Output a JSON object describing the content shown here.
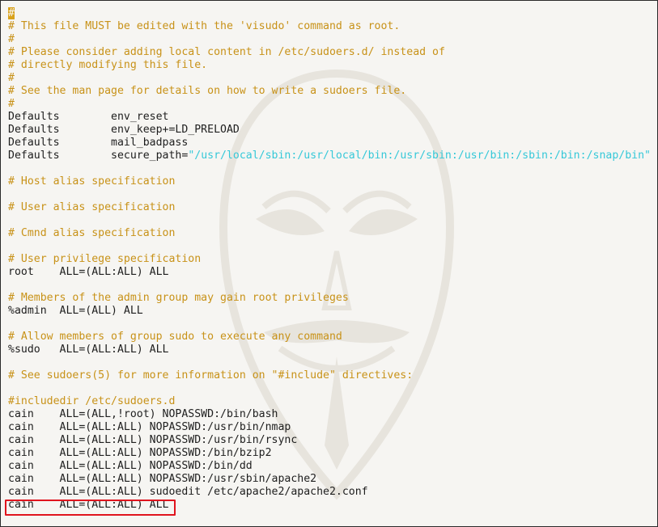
{
  "cursor_char": "#",
  "lines": [
    {
      "kind": "cursor-comment",
      "text": ""
    },
    {
      "kind": "comment",
      "text": "# This file MUST be edited with the 'visudo' command as root."
    },
    {
      "kind": "comment",
      "text": "#"
    },
    {
      "kind": "comment",
      "text": "# Please consider adding local content in /etc/sudoers.d/ instead of"
    },
    {
      "kind": "comment",
      "text": "# directly modifying this file."
    },
    {
      "kind": "comment",
      "text": "#"
    },
    {
      "kind": "comment",
      "text": "# See the man page for details on how to write a sudoers file."
    },
    {
      "kind": "comment",
      "text": "#"
    },
    {
      "kind": "plain",
      "text": "Defaults        env_reset"
    },
    {
      "kind": "plain",
      "text": "Defaults        env_keep+=LD_PRELOAD"
    },
    {
      "kind": "plain",
      "text": "Defaults        mail_badpass"
    },
    {
      "kind": "secure",
      "prefix": "Defaults        secure_path=",
      "string": "\"/usr/local/sbin:/usr/local/bin:/usr/sbin:/usr/bin:/sbin:/bin:/snap/bin\""
    },
    {
      "kind": "blank",
      "text": ""
    },
    {
      "kind": "comment",
      "text": "# Host alias specification"
    },
    {
      "kind": "blank",
      "text": ""
    },
    {
      "kind": "comment",
      "text": "# User alias specification"
    },
    {
      "kind": "blank",
      "text": ""
    },
    {
      "kind": "comment",
      "text": "# Cmnd alias specification"
    },
    {
      "kind": "blank",
      "text": ""
    },
    {
      "kind": "comment",
      "text": "# User privilege specification"
    },
    {
      "kind": "plain",
      "text": "root    ALL=(ALL:ALL) ALL"
    },
    {
      "kind": "blank",
      "text": ""
    },
    {
      "kind": "comment",
      "text": "# Members of the admin group may gain root privileges"
    },
    {
      "kind": "plain",
      "text": "%admin  ALL=(ALL) ALL"
    },
    {
      "kind": "blank",
      "text": ""
    },
    {
      "kind": "comment",
      "text": "# Allow members of group sudo to execute any command"
    },
    {
      "kind": "plain",
      "text": "%sudo   ALL=(ALL:ALL) ALL"
    },
    {
      "kind": "blank",
      "text": ""
    },
    {
      "kind": "comment",
      "text": "# See sudoers(5) for more information on \"#include\" directives:"
    },
    {
      "kind": "blank",
      "text": ""
    },
    {
      "kind": "comment",
      "text": "#includedir /etc/sudoers.d"
    },
    {
      "kind": "plain",
      "text": "cain    ALL=(ALL,!root) NOPASSWD:/bin/bash"
    },
    {
      "kind": "plain",
      "text": "cain    ALL=(ALL:ALL) NOPASSWD:/usr/bin/nmap"
    },
    {
      "kind": "plain",
      "text": "cain    ALL=(ALL:ALL) NOPASSWD:/usr/bin/rsync"
    },
    {
      "kind": "plain",
      "text": "cain    ALL=(ALL:ALL) NOPASSWD:/bin/bzip2"
    },
    {
      "kind": "plain",
      "text": "cain    ALL=(ALL:ALL) NOPASSWD:/bin/dd"
    },
    {
      "kind": "plain",
      "text": "cain    ALL=(ALL:ALL) NOPASSWD:/usr/sbin/apache2"
    },
    {
      "kind": "plain",
      "text": "cain    ALL=(ALL:ALL) sudoedit /etc/apache2/apache2.conf"
    },
    {
      "kind": "plain",
      "text": "cain    ALL=(ALL:ALL) ALL",
      "highlighted": true
    }
  ],
  "colors": {
    "comment": "#c89218",
    "plain": "#1e1e1e",
    "string": "#35c8d8",
    "cursor": "#d9a21b",
    "highlight_border": "#e0141e",
    "background": "#f6f5f2"
  },
  "watermark_icon": "guy-fawkes-mask-icon"
}
